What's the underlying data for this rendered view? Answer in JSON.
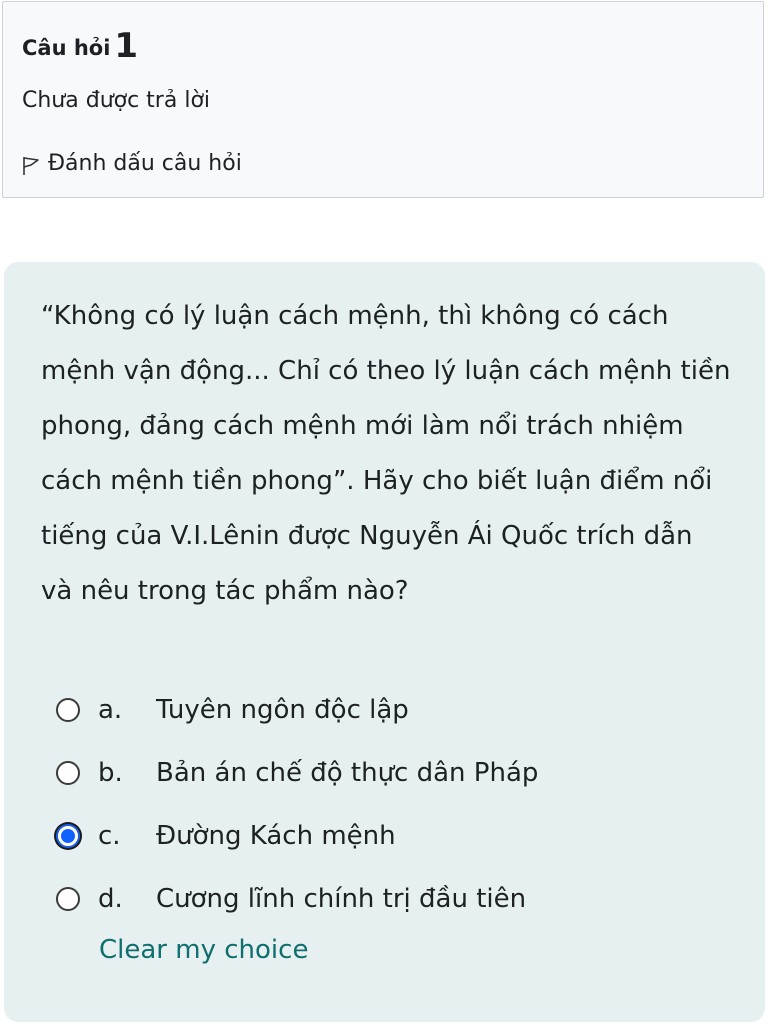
{
  "question_info": {
    "title_label": "Câu hỏi",
    "number": "1",
    "state": "Chưa được trả lời",
    "flag_label": "Đánh dấu câu hỏi",
    "flag_icon": "flag-outline-icon"
  },
  "question": {
    "text": "“Không có lý luận cách mệnh, thì không có cách mệnh vận động... Chỉ có theo lý luận cách mệnh tiền phong, đảng cách mệnh mới làm nổi trách nhiệm cách mệnh tiền phong”. Hãy cho biết luận điểm nổi tiếng của V.I.Lênin được Nguyễn Ái Quốc trích dẫn và nêu trong tác phẩm nào?"
  },
  "answers": [
    {
      "letter": "a.",
      "text": "Tuyên ngôn độc lập",
      "selected": false
    },
    {
      "letter": "b.",
      "text": "Bản án chế độ thực dân Pháp",
      "selected": false
    },
    {
      "letter": "c.",
      "text": "Đường Kách mệnh",
      "selected": true
    },
    {
      "letter": "d.",
      "text": "Cương lĩnh chính trị đầu tiên",
      "selected": false
    }
  ],
  "clear_choice_label": "Clear my choice",
  "colors": {
    "info_background": "#f8f9fa",
    "content_background": "#e7f0f1",
    "radio_selected": "#0f62fe",
    "link": "#0f6e6e"
  }
}
